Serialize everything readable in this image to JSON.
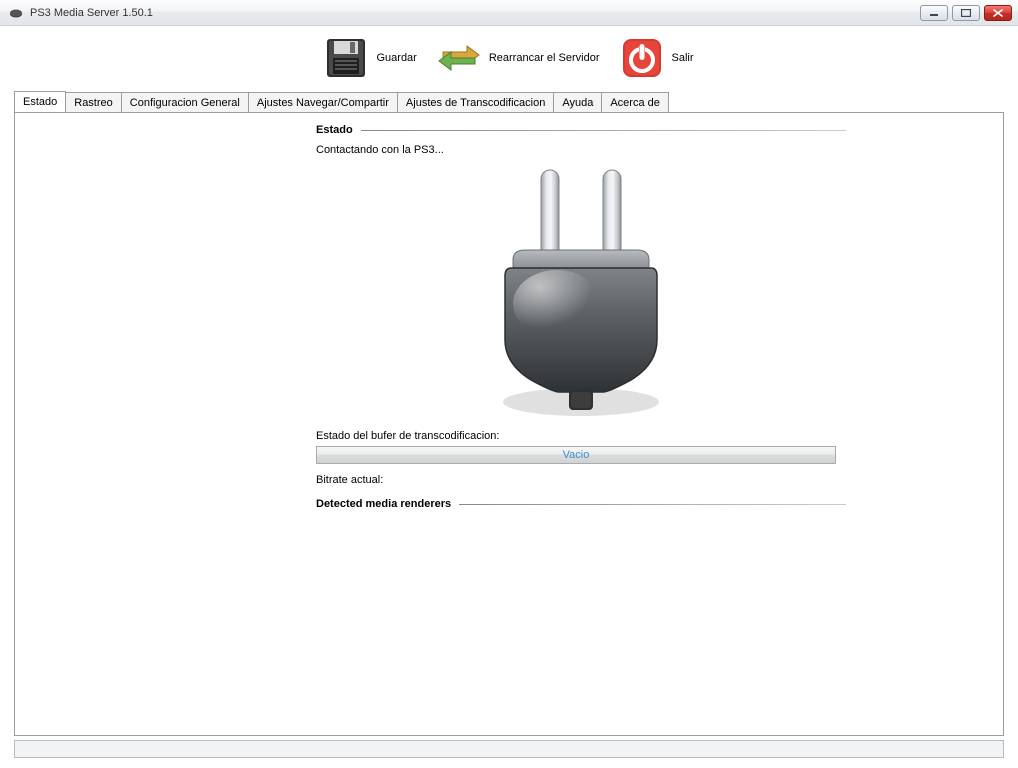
{
  "window": {
    "title": "PS3 Media Server 1.50.1"
  },
  "toolbar": {
    "save_label": "Guardar",
    "restart_label": "Rearrancar el Servidor",
    "quit_label": "Salir"
  },
  "tabs": [
    "Estado",
    "Rastreo",
    "Configuracion General",
    "Ajustes Navegar/Compartir",
    "Ajustes de Transcodificacion",
    "Ayuda",
    "Acerca de"
  ],
  "status": {
    "section_title": "Estado",
    "contacting": "Contactando con la PS3...",
    "buffer_label": "Estado del bufer de transcodificacion:",
    "buffer_value": "Vacio",
    "bitrate_label": "Bitrate actual:",
    "detected_title": "Detected media renderers"
  }
}
